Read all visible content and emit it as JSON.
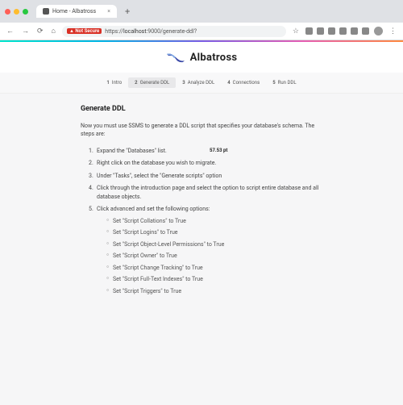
{
  "browser": {
    "tab_title": "Home - Albatross",
    "new_tab": "+",
    "back": "←",
    "forward": "→",
    "reload": "⟳",
    "home": "⌂",
    "url_warn": "Not Secure",
    "url_scheme_sep": " | ",
    "url_scheme": "https://",
    "url_host": "localhost",
    "url_path": ":9000/generate-ddl?",
    "star": "☆",
    "menu": "⋮"
  },
  "brand": "Albatross",
  "steps": [
    {
      "num": "1",
      "label": "Intro"
    },
    {
      "num": "2",
      "label": "Generate DDL"
    },
    {
      "num": "3",
      "label": "Analyze DDL"
    },
    {
      "num": "4",
      "label": "Connections"
    },
    {
      "num": "5",
      "label": "Run DDL"
    }
  ],
  "page": {
    "title": "Generate DDL",
    "intro": "Now you must use SSMS to generate a DDL script that specifies your database's schema. The steps are:",
    "note": "57.53 pt",
    "ol": [
      "Expand the \"Databases\" list.",
      "Right click on the database you wish to migrate.",
      "Under \"Tasks\", select the \"Generate scripts\" option",
      "Click through the introduction page and select the option to script entire database and all database objects.",
      "Click advanced and set the following options:"
    ],
    "ul": [
      "Set \"Script Collations\" to True",
      "Set \"Script Logins\" to True",
      "Set \"Script Object-Level Permissions\" to True",
      "Set \"Script Owner\" to True",
      "Set \"Script Change Tracking\" to True",
      "Set \"Script Full-Text Indexes\" to True",
      "Set \"Script Triggers\" to True"
    ]
  }
}
